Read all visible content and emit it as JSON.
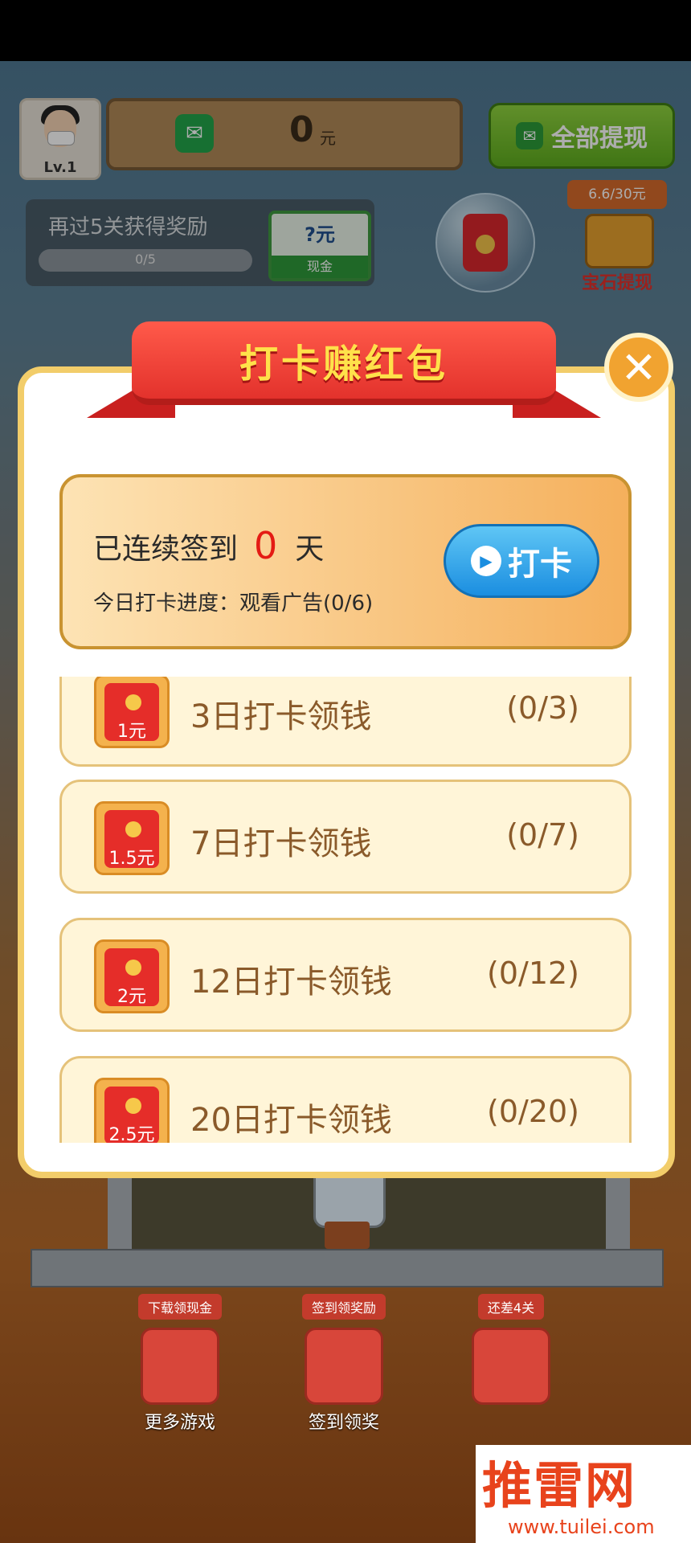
{
  "hud": {
    "level": "Lv.1",
    "balance": "0",
    "balance_unit": "元",
    "withdraw_all": "全部提现"
  },
  "level_reward": {
    "text": "再过5关获得奖励",
    "progress": "0/5",
    "progress_fraction": 0,
    "reward_value": "?元",
    "reward_type": "现金"
  },
  "gem": {
    "progress": "6.6/30元",
    "label": "宝石提现"
  },
  "modal": {
    "title": "打卡赚红包",
    "streak_prefix": "已连续签到",
    "streak_days": "0",
    "streak_suffix": "天",
    "today_progress": "今日打卡进度：观看广告(0/6)",
    "checkin_button": "打卡",
    "tasks": [
      {
        "amount": "1元",
        "label": "3日打卡领钱",
        "progress": "(0/3)"
      },
      {
        "amount": "1.5元",
        "label": "7日打卡领钱",
        "progress": "(0/7)"
      },
      {
        "amount": "2元",
        "label": "12日打卡领钱",
        "progress": "(0/12)"
      },
      {
        "amount": "2.5元",
        "label": "20日打卡领钱",
        "progress": "(0/20)"
      }
    ]
  },
  "bottom_bar": [
    {
      "tag": "下载领现金",
      "name": "更多游戏"
    },
    {
      "tag": "签到领奖励",
      "name": "签到领奖"
    },
    {
      "tag": "还差4关",
      "name": ""
    }
  ],
  "watermark": {
    "brand": "推雷网",
    "url": "www.tuilei.com"
  },
  "colors": {
    "ribbon_red": "#e3322c",
    "title_yellow": "#ffe14a",
    "checkin_blue": "#1b8ee0",
    "streak_red": "#e41b14",
    "withdraw_green": "#5fae1f"
  }
}
